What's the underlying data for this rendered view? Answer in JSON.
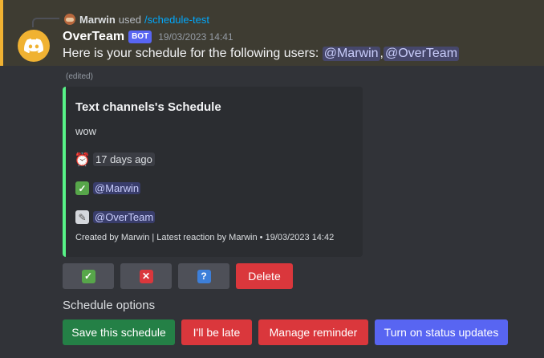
{
  "reply": {
    "user": "Marwin",
    "used_text": "used",
    "command": "/schedule-test"
  },
  "message": {
    "author": "OverTeam",
    "bot_tag": "BOT",
    "timestamp": "19/03/2023 14:41",
    "text": "Here is your schedule for the following users:",
    "mention1": "@Marwin",
    "separator": ",",
    "mention2": "@OverTeam",
    "edited": "(edited)"
  },
  "embed": {
    "accent_color": "#57f287",
    "title": "Text channels's Schedule",
    "description": "wow",
    "time_icon": "alarm-clock-icon",
    "time_value": "17 days ago",
    "yes_icon": "check-box-icon",
    "yes_user": "@Marwin",
    "maybe_icon": "pencil-icon",
    "maybe_user": "@OverTeam",
    "footer": "Created by Marwin | Latest reaction by Marwin • 19/03/2023 14:42"
  },
  "reaction_buttons": {
    "accept_icon": "check-icon",
    "decline_icon": "x-icon",
    "maybe_icon": "question-icon",
    "delete_label": "Delete"
  },
  "options": {
    "section_label": "Schedule options",
    "save_label": "Save this schedule",
    "late_label": "I'll be late",
    "reminder_label": "Manage reminder",
    "status_label": "Turn on status updates"
  },
  "colors": {
    "bot_avatar": "#f0b232",
    "blurple": "#5865f2",
    "danger": "#da373c",
    "success": "#248046"
  }
}
